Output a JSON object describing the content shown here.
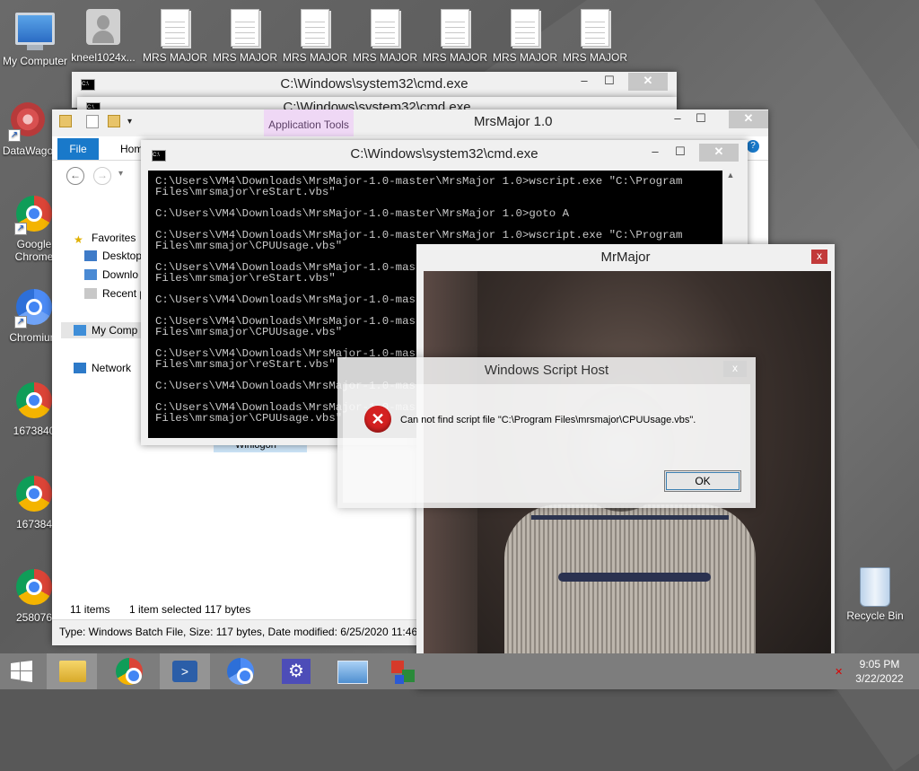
{
  "desktop": {
    "icons": [
      {
        "label": "My Computer"
      },
      {
        "label": "kneel1024x..."
      },
      {
        "label": "MRS MAJOR"
      },
      {
        "label": "MRS MAJOR"
      },
      {
        "label": "MRS MAJOR"
      },
      {
        "label": "MRS MAJOR"
      },
      {
        "label": "MRS MAJOR"
      },
      {
        "label": "MRS MAJOR"
      },
      {
        "label": "MRS MAJOR"
      },
      {
        "label": "DataWago"
      },
      {
        "label": "Google Chrome"
      },
      {
        "label": "Chromium"
      },
      {
        "label": "1673840"
      },
      {
        "label": "167384"
      },
      {
        "label": "258076"
      },
      {
        "label": "Recycle Bin"
      }
    ]
  },
  "cmd_back": {
    "title": "C:\\Windows\\system32\\cmd.exe"
  },
  "cmd_back2": {
    "title": "C:\\Windows\\system32\\cmd.exe"
  },
  "explorer": {
    "title": "MrsMajor 1.0",
    "contextual_tab": "Application Tools",
    "tabs": {
      "file": "File",
      "home": "Hom"
    },
    "nav": {
      "favorites": "Favorites",
      "desktop": "Desktop",
      "downloads": "Downlo",
      "recent": "Recent p",
      "my_computer": "My Comp",
      "network": "Network"
    },
    "partial_file": "Winlogon",
    "status": {
      "items": "11 items",
      "selected": "1 item selected  117 bytes"
    },
    "details": "Type: Windows Batch File, Size: 117 bytes, Date modified: 6/25/2020 11:46 AM"
  },
  "cmd_front": {
    "title": "C:\\Windows\\system32\\cmd.exe",
    "lines": [
      "C:\\Users\\VM4\\Downloads\\MrsMajor-1.0-master\\MrsMajor 1.0>wscript.exe \"C:\\Program",
      "Files\\mrsmajor\\reStart.vbs\"",
      "",
      "C:\\Users\\VM4\\Downloads\\MrsMajor-1.0-master\\MrsMajor 1.0>goto A",
      "",
      "C:\\Users\\VM4\\Downloads\\MrsMajor-1.0-master\\MrsMajor 1.0>wscript.exe \"C:\\Program",
      "Files\\mrsmajor\\CPUUsage.vbs\"",
      "",
      "C:\\Users\\VM4\\Downloads\\MrsMajor-1.0-master\\MrsMajor 1.0>wscript.exe \"C:\\Program",
      "Files\\mrsmajor\\reStart.vbs\"",
      "",
      "C:\\Users\\VM4\\Downloads\\MrsMajor-1.0-master\\MrsMajor 1.0>goto A",
      "",
      "C:\\Users\\VM4\\Downloads\\MrsMajor-1.0-master\\MrsMajor 1.0>wscript.exe \"C:\\Program",
      "Files\\mrsmajor\\CPUUsage.vbs\"",
      "",
      "C:\\Users\\VM4\\Downloads\\MrsMajor-1.0-master\\MrsMajor 1.0>wscript.exe \"C:\\Program",
      "Files\\mrsmajor\\reStart.vbs\"",
      "",
      "C:\\Users\\VM4\\Downloads\\MrsMajor-1.0-master\\MrsMajor 1.0>goto A",
      "",
      "C:\\Users\\VM4\\Downloads\\MrsMajor-1.0-master\\MrsMajor 1.0>wscript.exe \"C:\\Program",
      "Files\\mrsmajor\\CPUUsage.vbs\""
    ]
  },
  "mrmajor": {
    "title": "MrMajor",
    "close": "x"
  },
  "dialog": {
    "title": "Windows Script Host",
    "message": "Can not find script file \"C:\\Program Files\\mrsmajor\\CPUUsage.vbs\".",
    "ok": "OK",
    "close": "x"
  },
  "taskbar": {
    "clock_time": "9:05 PM",
    "clock_date": "3/22/2022"
  },
  "colors": {
    "explorer_file_tab": "#1979ca",
    "contextual_tab": "#efd8f5",
    "error_red": "#d42121"
  }
}
